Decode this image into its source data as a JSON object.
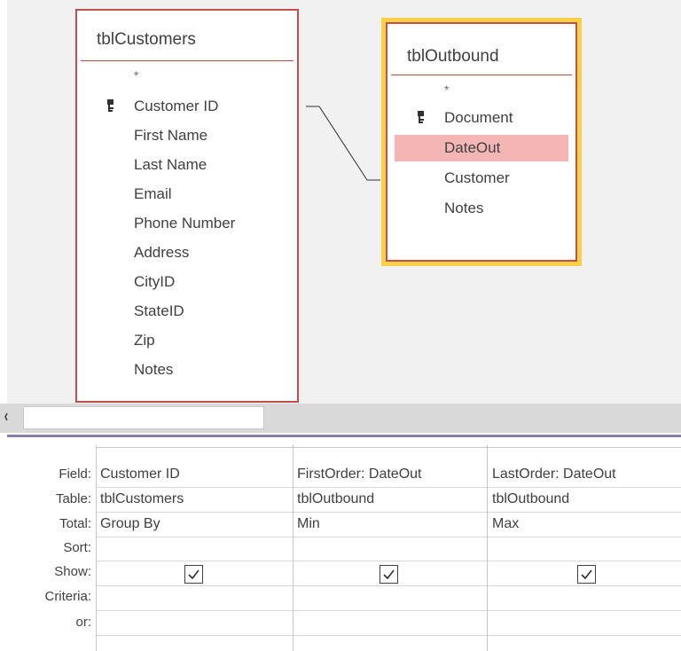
{
  "tables": {
    "customers": {
      "title": "tblCustomers",
      "star": "*",
      "fields": [
        "Customer ID",
        "First Name",
        "Last Name",
        "Email",
        "Phone Number",
        "Address",
        "CityID",
        "StateID",
        "Zip",
        "Notes"
      ]
    },
    "outbound": {
      "title": "tblOutbound",
      "star": "*",
      "fields": [
        "Document",
        "DateOut",
        "Customer",
        "Notes"
      ]
    }
  },
  "grid": {
    "row_labels": [
      "Field:",
      "Table:",
      "Total:",
      "Sort:",
      "Show:",
      "Criteria:",
      "or:"
    ],
    "columns": [
      {
        "field": "Customer ID",
        "table": "tblCustomers",
        "total": "Group By",
        "show": true
      },
      {
        "field": "FirstOrder: DateOut",
        "table": "tblOutbound",
        "total": "Min",
        "show": true
      },
      {
        "field": "LastOrder: DateOut",
        "table": "tblOutbound",
        "total": "Max",
        "show": true
      }
    ]
  },
  "colors": {
    "table_border": "#c0504d",
    "selected_table_highlight": "#f9d046",
    "selected_field": "#f4b6b4"
  },
  "icons": {
    "primary_key": "key-icon",
    "check": "checkmark-icon"
  }
}
